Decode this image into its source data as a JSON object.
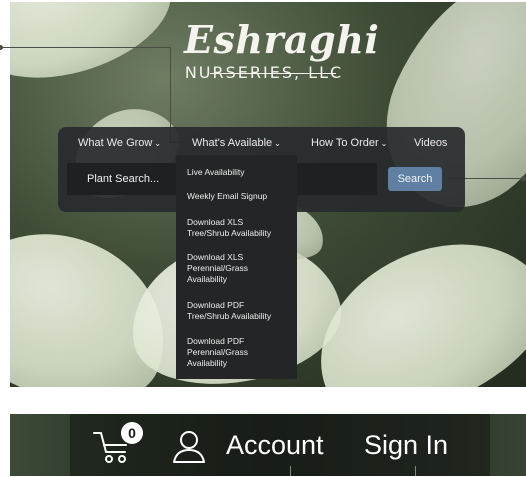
{
  "logo": {
    "name": "Eshraghi",
    "subtitle": "NURSERIES, LLC"
  },
  "nav": {
    "items": [
      {
        "label": "What We Grow",
        "has_dropdown": true
      },
      {
        "label": "What's Available",
        "has_dropdown": true
      },
      {
        "label": "How To Order",
        "has_dropdown": true
      },
      {
        "label": "Videos",
        "has_dropdown": false
      }
    ],
    "chevron_icon": "chevron-down-icon"
  },
  "search": {
    "placeholder": "Plant Search...",
    "button_label": "Search"
  },
  "dropdown": {
    "items": [
      {
        "lines": [
          "Live Availability"
        ]
      },
      {
        "lines": [
          "Weekly Email Signup"
        ]
      },
      {
        "lines": [
          "Download XLS",
          "Tree/Shrub Availability"
        ]
      },
      {
        "lines": [
          "Download XLS",
          "Perennial/Grass",
          "Availability"
        ]
      },
      {
        "lines": [
          "Download PDF",
          "Tree/Shrub Availability"
        ]
      },
      {
        "lines": [
          "Download PDF",
          "Perennial/Grass",
          "Availability"
        ]
      }
    ]
  },
  "header_bar": {
    "cart_count": "0",
    "cart_icon": "cart-icon",
    "user_icon": "user-icon",
    "account_label": "Account",
    "sign_in_label": "Sign In"
  },
  "colors": {
    "nav_panel": "#282a2c",
    "search_button": "#5f7fa3",
    "dropdown_bg": "#242526"
  }
}
